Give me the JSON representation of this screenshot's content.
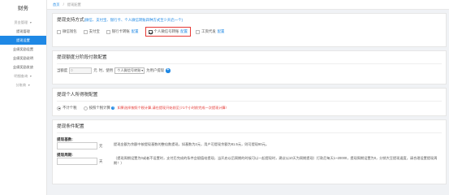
{
  "sidebar": {
    "title": "财务",
    "items": [
      {
        "label": "资金管理",
        "type": "group"
      },
      {
        "label": "提现管理",
        "type": "item"
      },
      {
        "label": "提现设置",
        "type": "active"
      },
      {
        "label": "业绩奖励设置",
        "type": "item"
      },
      {
        "label": "业绩奖励说明",
        "type": "item"
      },
      {
        "label": "业绩奖励发放",
        "type": "item"
      },
      {
        "label": "明细查询",
        "type": "group"
      },
      {
        "label": "分账商",
        "type": "group"
      }
    ]
  },
  "breadcrumb": {
    "home": "首页",
    "separator": "/",
    "current": "提现配置"
  },
  "methods": {
    "title": "提现支持方式",
    "subtitle": "(微信、支付宝、银行卡、个人微信转账四种方式至少开启一个)",
    "options": [
      {
        "label": "微信钱包",
        "checked": false,
        "link": ""
      },
      {
        "label": "支付宝",
        "checked": false,
        "link": ""
      },
      {
        "label": "银行卡转账",
        "checked": false,
        "link": "配置"
      },
      {
        "label": "个人微信号转账",
        "checked": true,
        "link": "配置"
      },
      {
        "label": "工资代发",
        "checked": false,
        "link": "配置"
      }
    ]
  },
  "amount": {
    "title": "提现额度分阶段付款配置",
    "prefix": "当额度",
    "input_value": "0",
    "unit": "元",
    "middle": "时，使用",
    "select_value": "个人微信号转账",
    "suffix": "为用户提现"
  },
  "tax": {
    "title": "提现个人所得税配置",
    "options": [
      {
        "label": "不计个税",
        "selected": true
      },
      {
        "label": "按照个税计算",
        "selected": false
      }
    ],
    "note": "如果选择按照个税计算,请在提现开始前至少1个小时前完成一次提现计算!"
  },
  "conditions": {
    "title": "提现条件配置",
    "base_label": "提现基数:",
    "base_unit": "元",
    "base_desc": "提现金额为余额中按提现基数的整倍数提现，如基数为2元，用户可提现余额为81.5元，则可提现80元。",
    "cycle_label": "提现周期:",
    "cycle_unit": "天",
    "cycle_desc": "（提现周期设置为0或者不设置时，支付后完成的条件会赋值给提现，当开启以后周期的时候可以一起提现时，建议以10天为周期提现）打款后每天1~20000，提现周期设置为0，分销大豆提现速度，请合理设置提现周期！）"
  }
}
